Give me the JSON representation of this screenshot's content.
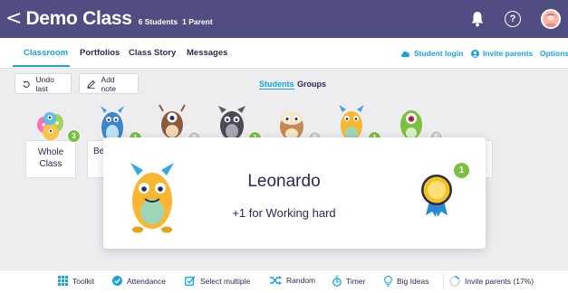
{
  "header": {
    "back_glyph": "<",
    "class_name": "Demo Class",
    "students_meta": "6 Students",
    "parents_meta": "1 Parent",
    "icons": [
      "bell-icon",
      "help-icon",
      "profile-avatar"
    ]
  },
  "nav": {
    "tabs": [
      {
        "label": "Classroom",
        "active": true
      },
      {
        "label": "Portfolios"
      },
      {
        "label": "Class Story"
      },
      {
        "label": "Messages"
      }
    ],
    "right": [
      {
        "label": "Student login",
        "icon": "cloud-icon"
      },
      {
        "label": "Invite parents",
        "icon": "parent-icon"
      },
      {
        "label": "Options"
      }
    ]
  },
  "toolbar": {
    "undo_label": "Undo last",
    "add_note_label": "Add note",
    "view_students": "Students",
    "view_groups": "Groups"
  },
  "roster": {
    "whole_class_label": "Whole Class",
    "partial_label": "Be",
    "points": [
      "3",
      "1",
      "0",
      "1",
      "0",
      "1",
      "0"
    ]
  },
  "award_popup": {
    "student_name": "Leonardo",
    "message": "+1 for Working hard",
    "badge_points": "1"
  },
  "bottom_bar": {
    "items": [
      {
        "label": "Toolkit",
        "icon": "grid-icon"
      },
      {
        "label": "Attendance",
        "icon": "attendance-icon"
      },
      {
        "label": "Select multiple",
        "icon": "checkbox-icon"
      },
      {
        "label": "Random",
        "icon": "shuffle-icon"
      },
      {
        "label": "Timer",
        "icon": "timer-icon"
      },
      {
        "label": "Big Ideas",
        "icon": "lightbulb-icon"
      }
    ],
    "invite_label": "Invite parents (17%)",
    "invite_progress": 0.17
  },
  "colors": {
    "header": "#4f4d82",
    "accent": "#1aa4da",
    "points_green": "#7ac143",
    "text": "#2c2a50"
  }
}
